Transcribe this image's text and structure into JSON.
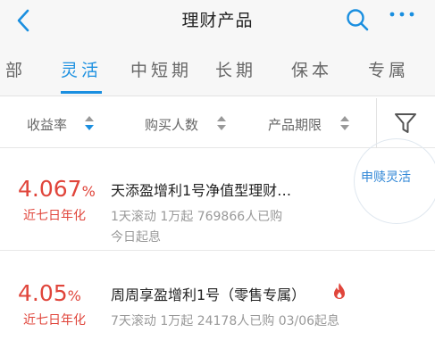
{
  "header": {
    "title": "理财产品"
  },
  "tabs": [
    {
      "label": "部",
      "active": false
    },
    {
      "label": "灵活",
      "active": true
    },
    {
      "label": "中短期",
      "active": false
    },
    {
      "label": "长期",
      "active": false
    },
    {
      "label": "保本",
      "active": false
    },
    {
      "label": "专属",
      "active": false
    }
  ],
  "filters": [
    {
      "label": "收益率",
      "sort": "descending"
    },
    {
      "label": "购买人数",
      "sort": "none"
    },
    {
      "label": "产品期限",
      "sort": "none"
    }
  ],
  "products": [
    {
      "rate": "4.067",
      "rate_unit": "%",
      "rate_label": "近七日年化",
      "name": "天添盈增利1号净值型理财…",
      "meta_line1": "1天滚动 1万起 769866人已购",
      "meta_line2": "今日起息",
      "badge": "申赎灵活"
    },
    {
      "rate": "4.05",
      "rate_unit": "%",
      "rate_label": "近七日年化",
      "name": "周周享盈增利1号（零售专属）",
      "meta_line1": "7天滚动 1万起 24178人已购 03/06起息",
      "hot_icon": "fire-icon"
    }
  ],
  "colors": {
    "accent": "#1a8fe0",
    "rate": "#e0453b",
    "muted": "#999999"
  }
}
